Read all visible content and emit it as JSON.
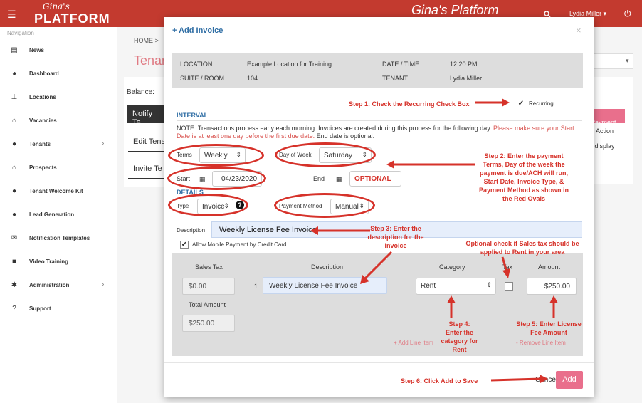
{
  "app": {
    "logo_script": "Gina's",
    "logo_main": "PLATFORM",
    "title": "Gina's Platform",
    "user": "Lydia Miller ▾"
  },
  "sidebar": {
    "heading": "Navigation",
    "items": [
      {
        "label": "News",
        "icon": "newspaper-icon"
      },
      {
        "label": "Dashboard",
        "icon": "dashboard-icon"
      },
      {
        "label": "Locations",
        "icon": "pin-icon"
      },
      {
        "label": "Vacancies",
        "icon": "lock-icon"
      },
      {
        "label": "Tenants",
        "icon": "user-icon"
      },
      {
        "label": "Prospects",
        "icon": "lock-icon"
      },
      {
        "label": "Tenant Welcome Kit",
        "icon": "user-icon"
      },
      {
        "label": "Lead Generation",
        "icon": "user-icon"
      },
      {
        "label": "Notification Templates",
        "icon": "envelope-icon"
      },
      {
        "label": "Video Training",
        "icon": "video-icon"
      },
      {
        "label": "Administration",
        "icon": "gear-icon"
      },
      {
        "label": "Support",
        "icon": "help-icon"
      }
    ]
  },
  "background": {
    "breadcrumb": "HOME  >",
    "tenant_heading": "Tenan",
    "balance": "Balance:",
    "notify": "Notify Te",
    "edit": "Edit Tena",
    "invite": "Invite Te",
    "payment_btn": "d Payment",
    "action": "Action",
    "to_display": "o display"
  },
  "modal": {
    "title": "+ Add Invoice",
    "close": "×",
    "info": {
      "location_label": "LOCATION",
      "location_value": "Example Location for Training",
      "datetime_label": "DATE / TIME",
      "datetime_value": "12:20 PM",
      "suite_label": "SUITE / ROOM",
      "suite_value": "104",
      "tenant_label": "TENANT",
      "tenant_value": "Lydia Miller"
    },
    "recurring_label": "Recurring",
    "interval_heading": "INTERVAL",
    "note_plain": "NOTE: Transactions process early each morning. Invoices are created during this process for the following day. ",
    "note_warn": "Please make sure your Start Date is at least one day before the first due date.",
    "note_end": " End date is optional.",
    "terms_label": "Terms",
    "terms_value": "Weekly",
    "dow_label": "Day of Week",
    "dow_value": "Saturday",
    "start_label": "Start",
    "start_value": "04/23/2020",
    "end_label": "End",
    "end_value": "OPTIONAL",
    "details_heading": "DETAILS",
    "type_label": "Type",
    "type_value": "Invoice",
    "payment_method_label": "Payment Method",
    "payment_method_value": "Manual",
    "description_label": "Description",
    "description_value": "Weekly License Fee Invoice",
    "mobile_payment_label": "Allow Mobile Payment by Credit Card",
    "line_items": {
      "headers": {
        "sales_tax": "Sales Tax",
        "description": "Description",
        "category": "Category",
        "tax": "Tax",
        "amount": "Amount"
      },
      "sales_tax_value": "$0.00",
      "row_number": "1.",
      "row_description": "Weekly License Fee Invoice",
      "row_category": "Rent",
      "row_amount": "$250.00",
      "total_label": "Total Amount",
      "total_value": "$250.00",
      "add_line": "+ Add Line Item",
      "remove_line": "- Remove Line Item"
    },
    "cancel_label": "Cancel",
    "add_label": "Add"
  },
  "annotations": {
    "step1": "Step 1: Check the Recurring Check Box",
    "step2": "Step 2: Enter the payment Terms, Day of the week the payment is due/ACH will run, Start Date, Invoice Type, & Payment Method as shown in the Red Ovals",
    "step3": "Step 3: Enter the description for the Invoice",
    "optional_tax": "Optional check if Sales tax should be applied to Rent in your area",
    "step4": "Step 4: Enter the category for Rent",
    "step5": "Step 5: Enter License Fee Amount",
    "step6": "Step 6: Click Add to Save"
  },
  "colors": {
    "brand_red": "#c33a2f",
    "accent_pink": "#e96f8c",
    "link_blue": "#2e6da4",
    "annotation_red": "#d6322a"
  }
}
